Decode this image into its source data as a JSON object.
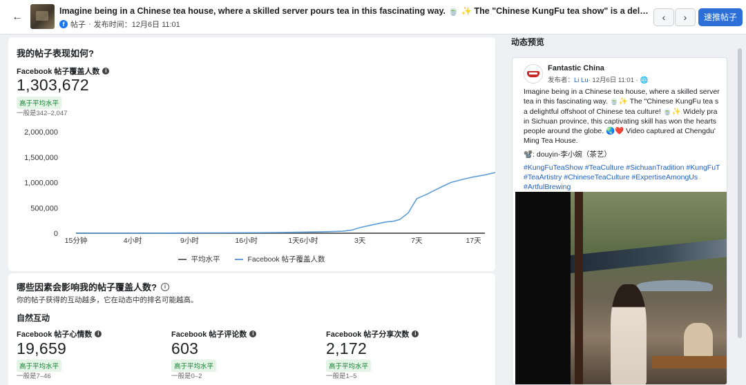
{
  "header": {
    "back_icon": "arrow-left-icon",
    "title": "Imagine being in a Chinese tea house, where a skilled server pours tea in this fascinating way. 🍵 ✨ The \"Chinese KungFu tea show\" is a delightful offshoot of Chinese tea culture! 🍵 ✨",
    "post_type": "帖子",
    "publish_label": "发布时间：12月6日 11:01",
    "prev_icon": "chevron-left-icon",
    "next_icon": "chevron-right-icon",
    "boost_label": "速推帖子"
  },
  "performance": {
    "title": "我的帖子表现如何?",
    "reach_label": "Facebook 帖子覆盖人数",
    "reach_value": "1,303,672",
    "badge": "高于平均水平",
    "typical_range": "一般是342–2,047"
  },
  "chart_data": {
    "type": "line",
    "y_tick_labels": [
      "2,000,000",
      "1,500,000",
      "1,000,000",
      "500,000",
      "0"
    ],
    "ylim": [
      0,
      2000000
    ],
    "x_tick_labels": [
      "15分钟",
      "4小时",
      "9小时",
      "16小时",
      "1天6小时",
      "3天",
      "7天",
      "17天"
    ],
    "series": [
      {
        "name": "平均水平",
        "color": "#666666",
        "points": [
          [
            0,
            0
          ],
          [
            7.2,
            0
          ]
        ]
      },
      {
        "name": "Facebook 帖子覆盖人数",
        "color": "#5b9bd5",
        "points": [
          [
            0,
            0
          ],
          [
            0.5,
            1000
          ],
          [
            1,
            2000
          ],
          [
            1.5,
            3000
          ],
          [
            2,
            5000
          ],
          [
            2.5,
            7000
          ],
          [
            3,
            10000
          ],
          [
            3.5,
            14000
          ],
          [
            4,
            22000
          ],
          [
            4.4,
            30000
          ],
          [
            4.7,
            40000
          ],
          [
            4.85,
            60000
          ],
          [
            5.0,
            110000
          ],
          [
            5.2,
            160000
          ],
          [
            5.45,
            220000
          ],
          [
            5.6,
            240000
          ],
          [
            5.7,
            270000
          ],
          [
            5.85,
            400000
          ],
          [
            6.0,
            680000
          ],
          [
            6.1,
            730000
          ],
          [
            6.2,
            780000
          ],
          [
            6.3,
            840000
          ],
          [
            6.45,
            920000
          ],
          [
            6.6,
            1000000
          ],
          [
            6.8,
            1060000
          ],
          [
            7.0,
            1110000
          ],
          [
            7.2,
            1150000
          ],
          [
            7.4,
            1200000
          ],
          [
            7.55,
            1240000
          ],
          [
            7.7,
            1260000
          ],
          [
            7.75,
            1262000
          ]
        ]
      }
    ],
    "legend": [
      "平均水平",
      "Facebook 帖子覆盖人数"
    ],
    "legend_position": "bottom-center",
    "grid": false
  },
  "factors": {
    "title": "哪些因素会影响我的帖子覆盖人数?",
    "info_icon": "info-icon",
    "description": "你的帖子获得的互动越多，它在动态中的排名可能越高。",
    "organic_label": "自然互动",
    "metrics": [
      {
        "label": "Facebook 帖子心情数",
        "value": "19,659",
        "badge": "高于平均水平",
        "range": "一般是7–46"
      },
      {
        "label": "Facebook 帖子评论数",
        "value": "603",
        "badge": "高于平均水平",
        "range": "一般是0–2"
      },
      {
        "label": "Facebook 帖子分享次数",
        "value": "2,172",
        "badge": "高于平均水平",
        "range": "一般是1–5"
      }
    ]
  },
  "preview": {
    "title": "动态预览",
    "page_name": "Fantastic China",
    "publisher_label": "发布者：",
    "author": "Li Lu",
    "meta_tail": "· 12月6日 11:01 · ",
    "globe_icon": "globe-icon",
    "body_lines": [
      "Imagine being in a Chinese tea house, where a skilled server",
      "tea in this fascinating way. 🍵✨ The \"Chinese KungFu tea s",
      "a delightful offshoot of Chinese tea culture! 🍵✨ Widely pra",
      "in Sichuan province, this captivating skill has won the hearts",
      "people around the globe. 🌏❤️ Video captured at Chengdu'",
      "Ming Tea House."
    ],
    "credit": "📽️: douyin-李小婉（茶艺）",
    "tag_lines": [
      "#KungFuTeaShow #TeaCulture #SichuanTradition #KungFuT",
      "#TeaArtistry #ChineseTeaCulture #ExpertiseAmongUs",
      "#ArtfulBrewing"
    ]
  }
}
